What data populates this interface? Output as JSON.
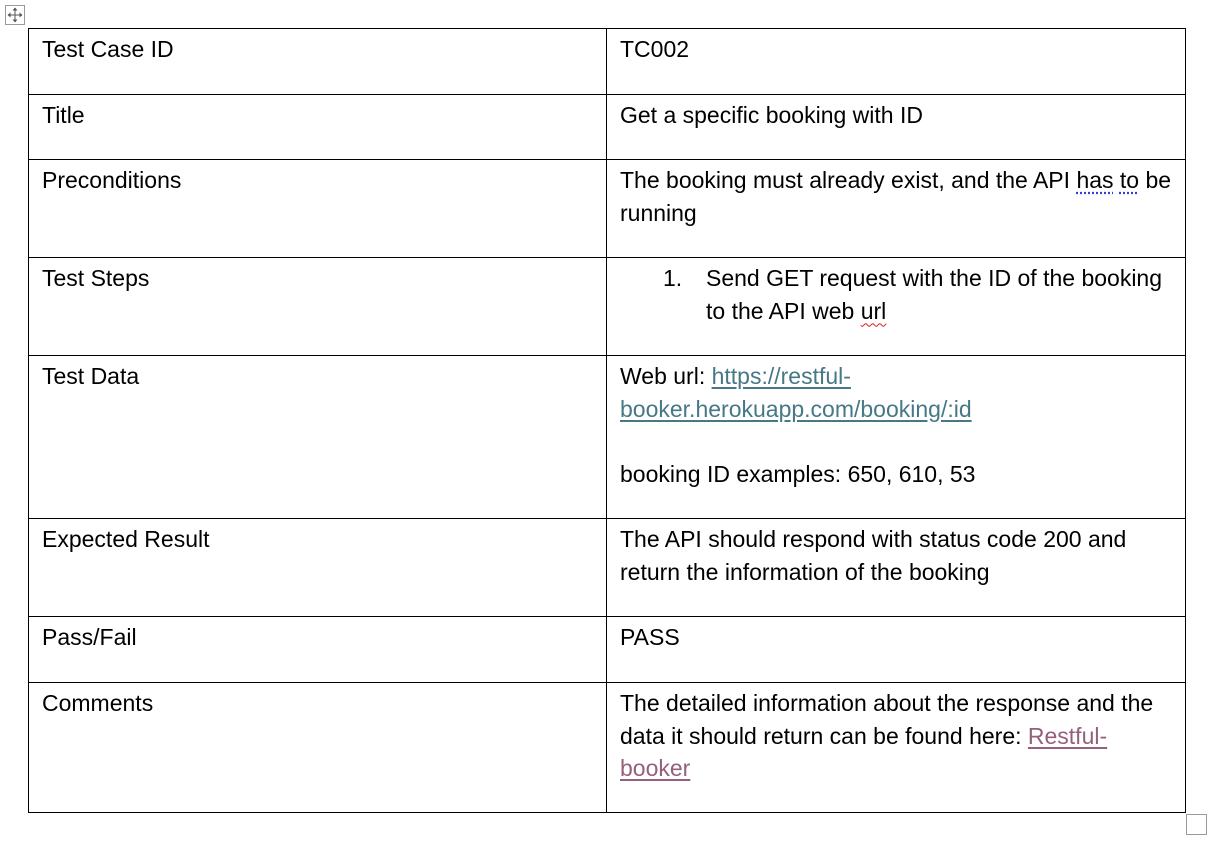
{
  "rows": [
    {
      "label": "Test Case ID",
      "value": "TC002"
    },
    {
      "label": "Title",
      "value": "Get a specific booking with ID"
    },
    {
      "label": "Preconditions",
      "value_parts": [
        "The booking must already exist, and the API ",
        "has",
        " ",
        "to",
        " be running"
      ]
    },
    {
      "label": "Test Steps",
      "step_number": "1.",
      "step_parts": [
        "Send GET request with the ID of the booking to the API web ",
        "url"
      ]
    },
    {
      "label": "Test Data",
      "prefix": "Web url: ",
      "link": "https://restful-booker.herokuapp.com/booking/:id",
      "examples": "booking ID examples: 650, 610, 53"
    },
    {
      "label": "Expected Result",
      "value": "The API should respond with status code 200 and return the information of the booking"
    },
    {
      "label": "Pass/Fail",
      "value": "PASS"
    },
    {
      "label": "Comments",
      "value": "The detailed information about the response and the data it should return can be found here: ",
      "link": "Restful-booker"
    }
  ],
  "icons": {
    "move_handle": "move-arrows-icon",
    "resize_handle": "resize-square-icon"
  },
  "colors": {
    "link": "#467886",
    "visited_link": "#96607d",
    "spelling": "#d12020",
    "grammar": "#3b3bd1"
  }
}
